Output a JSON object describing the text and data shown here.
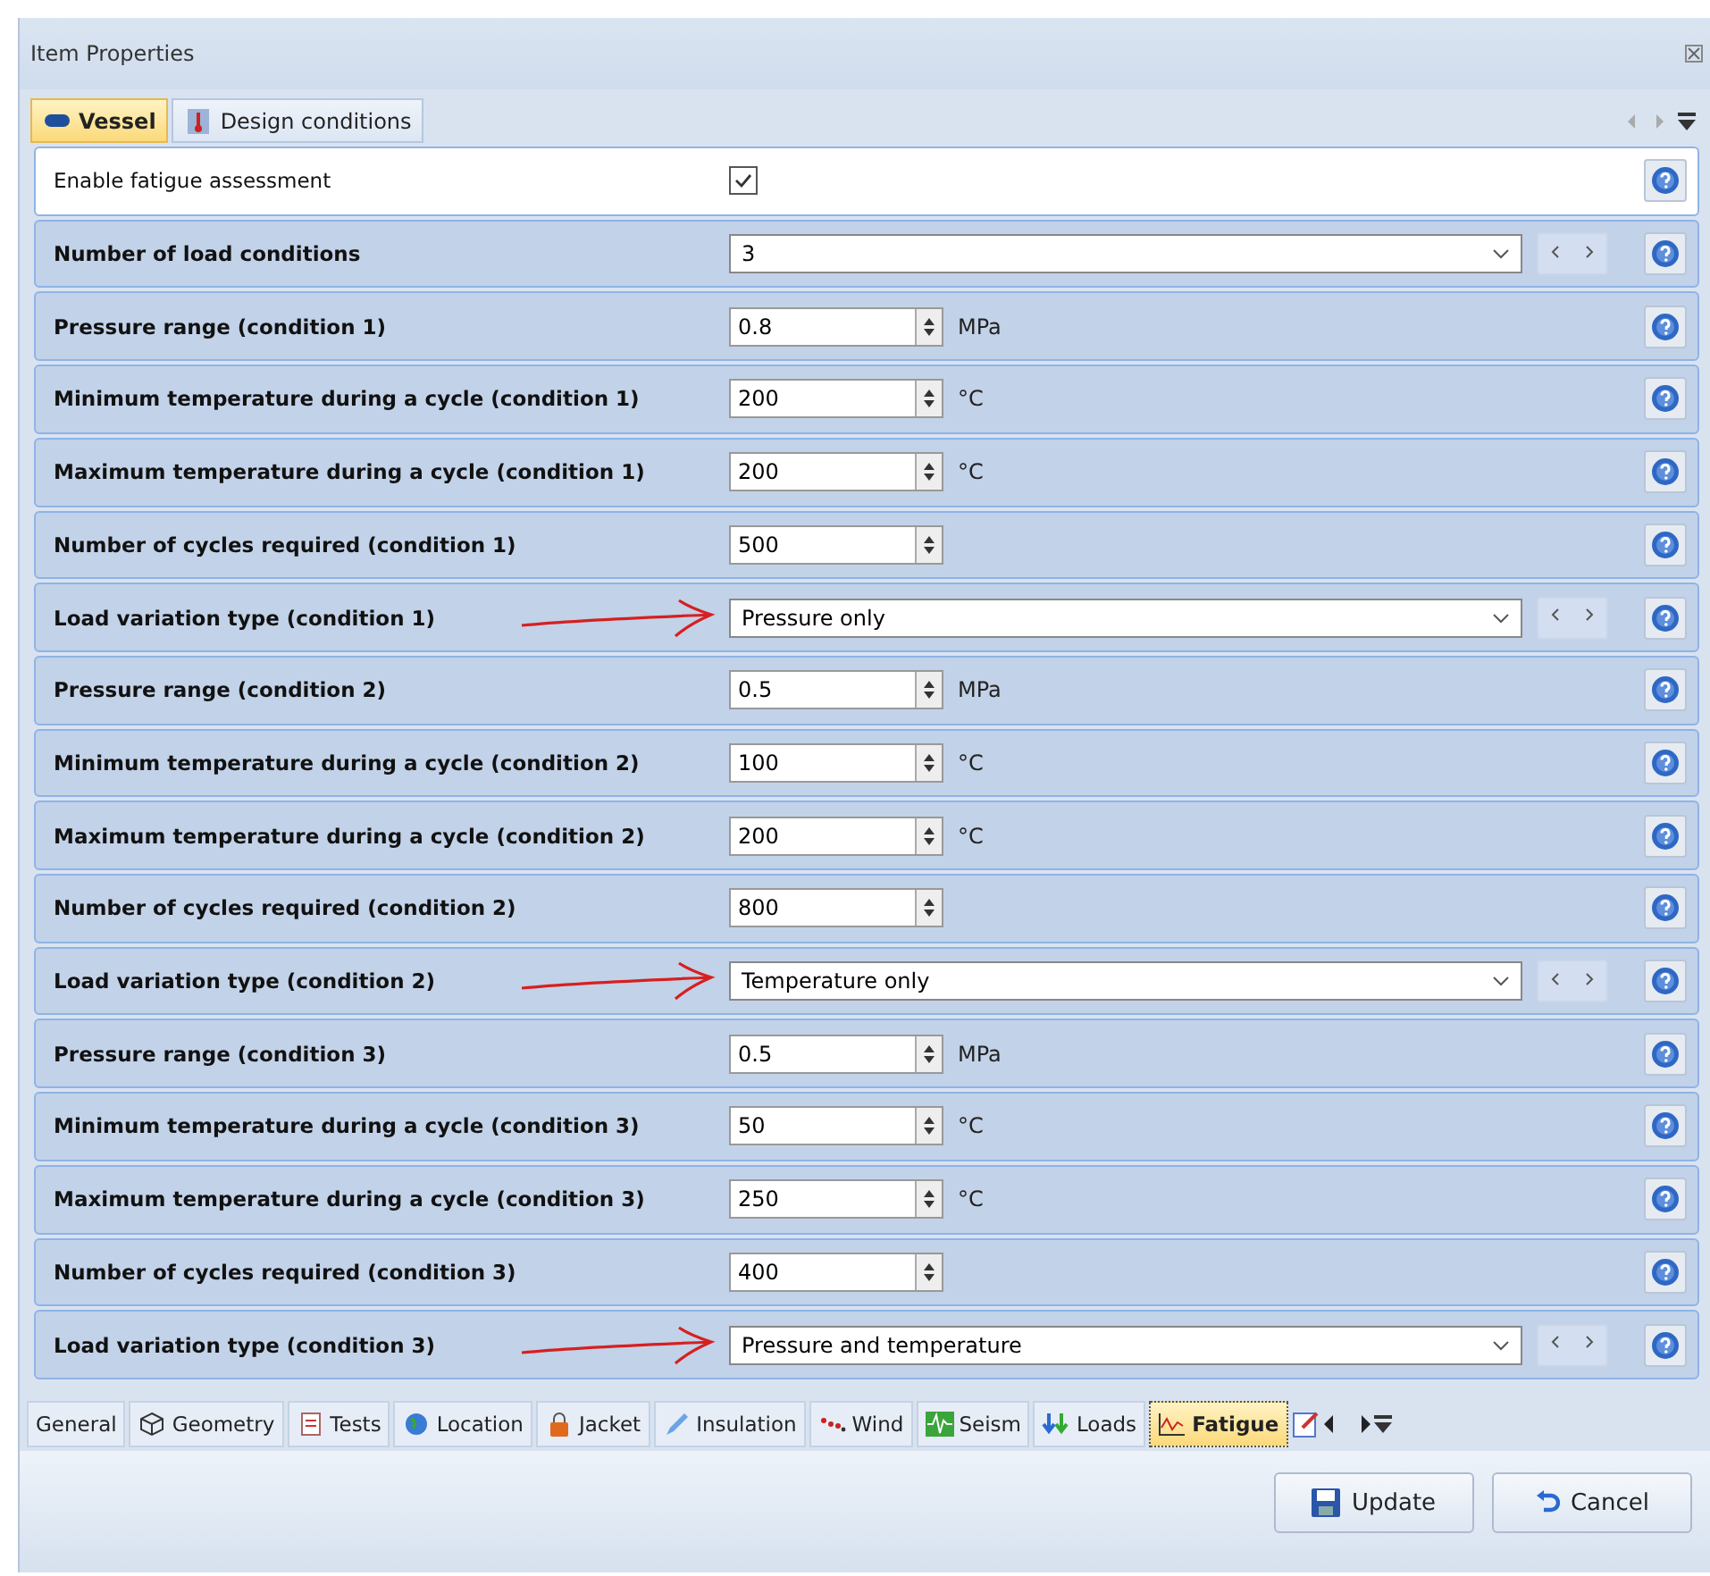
{
  "window": {
    "title": "Item Properties"
  },
  "top_tabs": [
    {
      "label": "Vessel",
      "selected": true
    },
    {
      "label": "Design conditions",
      "selected": false
    }
  ],
  "rows": [
    {
      "kind": "checkbox",
      "label": "Enable fatigue assessment",
      "checked": true
    },
    {
      "kind": "dropdown",
      "label": "Number of load conditions",
      "value": "3"
    },
    {
      "kind": "spinner",
      "label": "Pressure range (condition 1)",
      "value": "0.8",
      "unit": "MPa"
    },
    {
      "kind": "spinner",
      "label": "Minimum temperature during a cycle (condition 1)",
      "value": "200",
      "unit": "°C"
    },
    {
      "kind": "spinner",
      "label": "Maximum temperature during a cycle (condition 1)",
      "value": "200",
      "unit": "°C"
    },
    {
      "kind": "spinner",
      "label": "Number of cycles required (condition 1)",
      "value": "500"
    },
    {
      "kind": "dropdown",
      "label": "Load variation type (condition 1)",
      "value": "Pressure only",
      "annotated": true
    },
    {
      "kind": "spinner",
      "label": "Pressure range (condition 2)",
      "value": "0.5",
      "unit": "MPa"
    },
    {
      "kind": "spinner",
      "label": "Minimum temperature during a cycle (condition 2)",
      "value": "100",
      "unit": "°C"
    },
    {
      "kind": "spinner",
      "label": "Maximum temperature during a cycle (condition 2)",
      "value": "200",
      "unit": "°C"
    },
    {
      "kind": "spinner",
      "label": "Number of cycles required (condition 2)",
      "value": "800"
    },
    {
      "kind": "dropdown",
      "label": "Load variation type (condition 2)",
      "value": "Temperature only",
      "annotated": true
    },
    {
      "kind": "spinner",
      "label": "Pressure range (condition 3)",
      "value": "0.5",
      "unit": "MPa"
    },
    {
      "kind": "spinner",
      "label": "Minimum temperature during a cycle (condition 3)",
      "value": "50",
      "unit": "°C"
    },
    {
      "kind": "spinner",
      "label": "Maximum temperature during a cycle (condition 3)",
      "value": "250",
      "unit": "°C"
    },
    {
      "kind": "spinner",
      "label": "Number of cycles required (condition 3)",
      "value": "400"
    },
    {
      "kind": "dropdown",
      "label": "Load variation type (condition 3)",
      "value": "Pressure and temperature",
      "annotated": true
    }
  ],
  "bottom_tabs": [
    {
      "label": "General",
      "selected": false
    },
    {
      "label": "Geometry",
      "selected": false
    },
    {
      "label": "Tests",
      "selected": false
    },
    {
      "label": "Location",
      "selected": false
    },
    {
      "label": "Jacket",
      "selected": false
    },
    {
      "label": "Insulation",
      "selected": false
    },
    {
      "label": "Wind",
      "selected": false
    },
    {
      "label": "Seism",
      "selected": false
    },
    {
      "label": "Loads",
      "selected": false
    },
    {
      "label": "Fatigue",
      "selected": true
    }
  ],
  "buttons": [
    {
      "label": "Update"
    },
    {
      "label": "Cancel"
    }
  ]
}
